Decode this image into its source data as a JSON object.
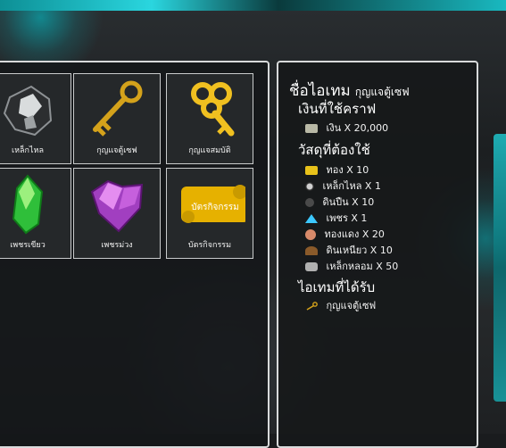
{
  "items": [
    {
      "label": "เหล็กไหล",
      "icon": "black-ore-icon"
    },
    {
      "label": "กุญแจตู้เซฟ",
      "icon": "safe-key-icon"
    },
    {
      "label": "กุญแจสมบัติ",
      "icon": "treasure-key-icon"
    },
    {
      "label": "เพชรเขียว",
      "icon": "green-gem-icon"
    },
    {
      "label": "เพชรม่วง",
      "icon": "purple-gem-icon"
    },
    {
      "label": "บัตรกิจกรรม",
      "icon": "event-card-icon",
      "card_text": "บัตรกิจกรรม"
    }
  ],
  "recipe": {
    "title_label": "ชื่อไอเทม",
    "item_name": "กุญแจตู้เซฟ",
    "money_heading": "เงินที่ใช้คราฟ",
    "money": {
      "text": "เงิน X 20,000",
      "icon": "cash-icon"
    },
    "materials_heading": "วัสดุที่ต้องใช้",
    "materials": [
      {
        "text": "ทอง X 10",
        "icon": "gold-bar-icon",
        "color": "#e8c21a"
      },
      {
        "text": "เหล็กไหล X 1",
        "icon": "black-ore-icon",
        "color": "#cfcfcf"
      },
      {
        "text": "ดินปืน X 10",
        "icon": "gunpowder-icon",
        "color": "#6a6a6a"
      },
      {
        "text": "เพชร X 1",
        "icon": "diamond-icon",
        "color": "#3cc8ff"
      },
      {
        "text": "ทองแดง X 20",
        "icon": "copper-icon",
        "color": "#d88a6a"
      },
      {
        "text": "ดินเหนียว X 10",
        "icon": "clay-icon",
        "color": "#9a6a3a"
      },
      {
        "text": "เหล็กหลอม X 50",
        "icon": "iron-ingot-icon",
        "color": "#b0b0b0"
      }
    ],
    "result_heading": "ไอเทมที่ได้รับ",
    "result": {
      "text": "กุญแจตู้เซฟ",
      "icon": "safe-key-icon"
    }
  }
}
